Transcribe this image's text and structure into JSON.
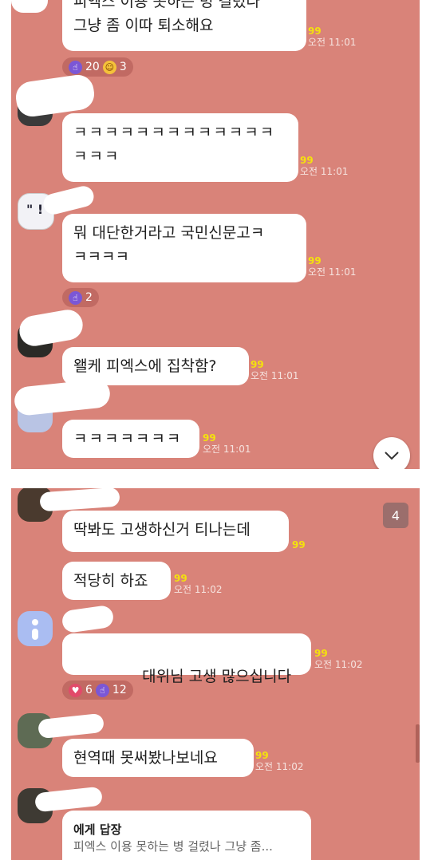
{
  "panel1": {
    "messages": [
      {
        "text": "피엑스 이용 못하는 병 걸렸나\n그냥 좀 이따 퇴소해요",
        "count": "99",
        "time": "오전 11:01"
      },
      {
        "text": "ㅋㅋㅋㅋㅋㅋㅋㅋㅋㅋㅋㅋㅋ\nㅋㅋㅋ",
        "count": "99",
        "time": "오전 11:01"
      },
      {
        "text": "뭐 대단한거라고 국민신문고ㅋ\nㅋㅋㅋㅋ",
        "count": "99",
        "time": "오전 11:01"
      },
      {
        "text": "왤케 피엑스에 집착함?",
        "count": "99",
        "time": "오전 11:01"
      },
      {
        "text": "ㅋㅋㅋㅋㅋㅋㅋ",
        "count": "99",
        "time": "오전 11:01"
      }
    ],
    "reactions": [
      {
        "like": "20",
        "laugh": "3"
      },
      {
        "like": "2"
      }
    ]
  },
  "panel2": {
    "unread_badge": "4",
    "messages": [
      {
        "text": "딱봐도 고생하신거 티나는데",
        "count": "99",
        "time": ""
      },
      {
        "text": "적당히 하죠",
        "count": "99",
        "time": "오전 11:02"
      },
      {
        "text": "대위님 고생 많으십니다",
        "count": "99",
        "time": "오전 11:02"
      },
      {
        "text": "현역때 못써봤나보네요",
        "count": "99",
        "time": "오전 11:02"
      }
    ],
    "reactions": [
      {
        "heart": "6",
        "like": "12"
      }
    ],
    "reply": {
      "header": "에게 답장",
      "preview": "피엑스 이용 못하는 병 걸렸나 그냥 좀..."
    }
  },
  "colors": {
    "chat_background": "#d98379",
    "bubble": "#ffffff",
    "unread_count": "#f4e10e",
    "like_reaction": "#7b57d6",
    "heart_reaction": "#e24a6a"
  },
  "icons": [
    "thumbs-up-icon",
    "laugh-emoji-icon",
    "heart-icon",
    "chevron-down-icon"
  ]
}
